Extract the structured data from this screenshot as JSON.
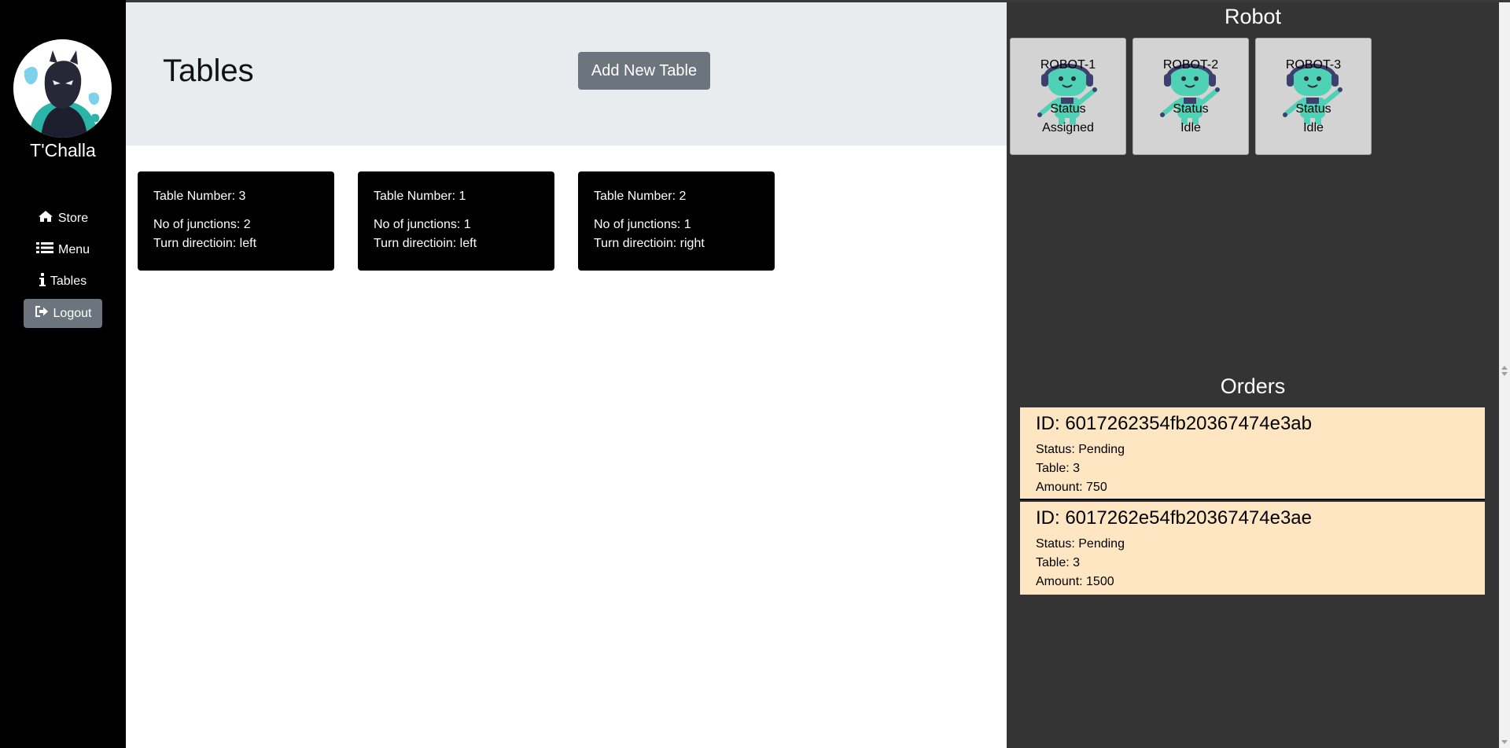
{
  "sidebar": {
    "username": "T'Challa",
    "nav": [
      {
        "label": "Store",
        "icon": "home-icon"
      },
      {
        "label": "Menu",
        "icon": "list-icon"
      },
      {
        "label": "Tables",
        "icon": "info-icon"
      }
    ],
    "logout_label": "Logout"
  },
  "header": {
    "title": "Tables",
    "add_button": "Add New Table"
  },
  "tables": [
    {
      "number": "Table Number: 3",
      "junctions": "No of junctions: 2",
      "direction": "Turn directioin: left"
    },
    {
      "number": "Table Number: 1",
      "junctions": "No of junctions: 1",
      "direction": "Turn directioin: left"
    },
    {
      "number": "Table Number: 2",
      "junctions": "No of junctions: 1",
      "direction": "Turn directioin: right"
    }
  ],
  "robots": {
    "title": "Robot",
    "items": [
      {
        "name": "ROBOT-1",
        "status_label": "Status",
        "status": "Assigned"
      },
      {
        "name": "ROBOT-2",
        "status_label": "Status",
        "status": "Idle"
      },
      {
        "name": "ROBOT-3",
        "status_label": "Status",
        "status": "Idle"
      }
    ]
  },
  "orders": {
    "title": "Orders",
    "items": [
      {
        "id": "ID: 6017262354fb20367474e3ab",
        "status": "Status: Pending",
        "table": "Table: 3",
        "amount": "Amount: 750"
      },
      {
        "id": "ID: 6017262e54fb20367474e3ae",
        "status": "Status: Pending",
        "table": "Table: 3",
        "amount": "Amount: 1500"
      }
    ]
  },
  "colors": {
    "sidebar_bg": "#000000",
    "header_bg": "#e9ecef",
    "button_bg": "#6c757d",
    "right_panel_bg": "#343434",
    "robot_card_bg": "#d3d3d3",
    "order_card_bg": "#ffe6c3",
    "robot_accent": "#4fd1b5"
  }
}
